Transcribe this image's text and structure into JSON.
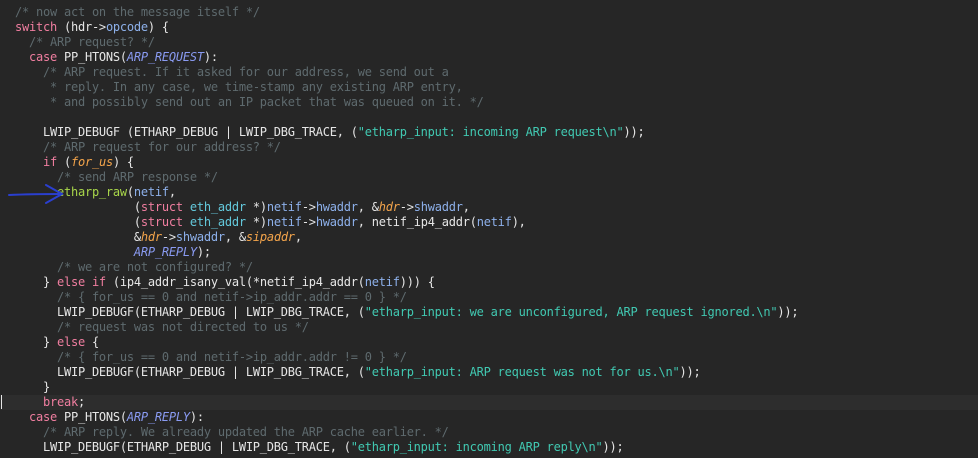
{
  "editor": {
    "theme_colors": {
      "background": "#262626",
      "comment": "#5e6a6e",
      "keyword": "#f07ea0",
      "function": "#a8d64a",
      "type": "#63c8db",
      "string": "#41c9b2",
      "parameter": "#f3a44b",
      "member": "#8db0ea",
      "enum_constant": "#8a9bf2",
      "annotation_arrow": "#2a3fd0"
    },
    "annotation_arrow_icon": "arrow-right-icon",
    "lines": [
      {
        "indent": "  ",
        "tokens": [
          {
            "t": "comment",
            "v": "/* now act on the message itself */"
          }
        ]
      },
      {
        "indent": "  ",
        "tokens": [
          {
            "t": "keyword",
            "v": "switch"
          },
          {
            "t": "plain",
            "v": " (hdr->"
          },
          {
            "t": "member",
            "v": "opcode"
          },
          {
            "t": "plain",
            "v": ") {"
          }
        ]
      },
      {
        "indent": "    ",
        "tokens": [
          {
            "t": "comment",
            "v": "/* ARP request? */"
          }
        ]
      },
      {
        "indent": "    ",
        "tokens": [
          {
            "t": "keyword",
            "v": "case"
          },
          {
            "t": "plain",
            "v": " PP_HTONS("
          },
          {
            "t": "enum",
            "v": "ARP_REQUEST"
          },
          {
            "t": "plain",
            "v": "):"
          }
        ]
      },
      {
        "indent": "      ",
        "tokens": [
          {
            "t": "comment",
            "v": "/* ARP request. If it asked for our address, we send out a"
          }
        ]
      },
      {
        "indent": "       ",
        "tokens": [
          {
            "t": "comment",
            "v": "* reply. In any case, we time-stamp any existing ARP entry,"
          }
        ]
      },
      {
        "indent": "       ",
        "tokens": [
          {
            "t": "comment",
            "v": "* and possibly send out an IP packet that was queued on it. */"
          }
        ]
      },
      {
        "indent": "",
        "tokens": []
      },
      {
        "indent": "      ",
        "tokens": [
          {
            "t": "plain",
            "v": "LWIP_DEBUGF (ETHARP_DEBUG | LWIP_DBG_TRACE, ("
          },
          {
            "t": "string",
            "v": "\"etharp_input: incoming ARP request\\n\""
          },
          {
            "t": "plain",
            "v": "));"
          }
        ]
      },
      {
        "indent": "      ",
        "tokens": [
          {
            "t": "comment",
            "v": "/* ARP request for our address? */"
          }
        ]
      },
      {
        "indent": "      ",
        "tokens": [
          {
            "t": "keyword",
            "v": "if"
          },
          {
            "t": "plain",
            "v": " ("
          },
          {
            "t": "param",
            "v": "for_us"
          },
          {
            "t": "plain",
            "v": ") {"
          }
        ]
      },
      {
        "indent": "        ",
        "tokens": [
          {
            "t": "comment",
            "v": "/* send ARP response */"
          }
        ]
      },
      {
        "indent": "        ",
        "tokens": [
          {
            "t": "func",
            "v": "etharp_raw"
          },
          {
            "t": "plain",
            "v": "("
          },
          {
            "t": "member",
            "v": "netif"
          },
          {
            "t": "plain",
            "v": ","
          }
        ]
      },
      {
        "indent": "                   ",
        "tokens": [
          {
            "t": "plain",
            "v": "("
          },
          {
            "t": "keyword",
            "v": "struct"
          },
          {
            "t": "plain",
            "v": " "
          },
          {
            "t": "type",
            "v": "eth_addr"
          },
          {
            "t": "plain",
            "v": " *)"
          },
          {
            "t": "member",
            "v": "netif"
          },
          {
            "t": "plain",
            "v": "->"
          },
          {
            "t": "member",
            "v": "hwaddr"
          },
          {
            "t": "plain",
            "v": ", &"
          },
          {
            "t": "param",
            "v": "hdr"
          },
          {
            "t": "plain",
            "v": "->"
          },
          {
            "t": "member",
            "v": "shwaddr"
          },
          {
            "t": "plain",
            "v": ","
          }
        ]
      },
      {
        "indent": "                   ",
        "tokens": [
          {
            "t": "plain",
            "v": "("
          },
          {
            "t": "keyword",
            "v": "struct"
          },
          {
            "t": "plain",
            "v": " "
          },
          {
            "t": "type",
            "v": "eth_addr"
          },
          {
            "t": "plain",
            "v": " *)"
          },
          {
            "t": "member",
            "v": "netif"
          },
          {
            "t": "plain",
            "v": "->"
          },
          {
            "t": "member",
            "v": "hwaddr"
          },
          {
            "t": "plain",
            "v": ", netif_ip4_addr("
          },
          {
            "t": "member",
            "v": "netif"
          },
          {
            "t": "plain",
            "v": "),"
          }
        ]
      },
      {
        "indent": "                   ",
        "tokens": [
          {
            "t": "plain",
            "v": "&"
          },
          {
            "t": "param",
            "v": "hdr"
          },
          {
            "t": "plain",
            "v": "->"
          },
          {
            "t": "member",
            "v": "shwaddr"
          },
          {
            "t": "plain",
            "v": ", &"
          },
          {
            "t": "param",
            "v": "sipaddr"
          },
          {
            "t": "plain",
            "v": ","
          }
        ]
      },
      {
        "indent": "                   ",
        "tokens": [
          {
            "t": "enum",
            "v": "ARP_REPLY"
          },
          {
            "t": "plain",
            "v": ");"
          }
        ]
      },
      {
        "indent": "        ",
        "tokens": [
          {
            "t": "comment",
            "v": "/* we are not configured? */"
          }
        ]
      },
      {
        "indent": "      ",
        "tokens": [
          {
            "t": "plain",
            "v": "} "
          },
          {
            "t": "keyword",
            "v": "else if"
          },
          {
            "t": "plain",
            "v": " (ip4_addr_isany_val(*netif_ip4_addr("
          },
          {
            "t": "member",
            "v": "netif"
          },
          {
            "t": "plain",
            "v": "))) {"
          }
        ]
      },
      {
        "indent": "        ",
        "tokens": [
          {
            "t": "comment",
            "v": "/* { for_us == 0 and netif->ip_addr.addr == 0 } */"
          }
        ]
      },
      {
        "indent": "        ",
        "tokens": [
          {
            "t": "plain",
            "v": "LWIP_DEBUGF(ETHARP_DEBUG | LWIP_DBG_TRACE, ("
          },
          {
            "t": "string",
            "v": "\"etharp_input: we are unconfigured, ARP request ignored.\\n\""
          },
          {
            "t": "plain",
            "v": "));"
          }
        ]
      },
      {
        "indent": "        ",
        "tokens": [
          {
            "t": "comment",
            "v": "/* request was not directed to us */"
          }
        ]
      },
      {
        "indent": "      ",
        "tokens": [
          {
            "t": "plain",
            "v": "} "
          },
          {
            "t": "keyword",
            "v": "else"
          },
          {
            "t": "plain",
            "v": " {"
          }
        ]
      },
      {
        "indent": "        ",
        "tokens": [
          {
            "t": "comment",
            "v": "/* { for_us == 0 and netif->ip_addr.addr != 0 } */"
          }
        ]
      },
      {
        "indent": "        ",
        "tokens": [
          {
            "t": "plain",
            "v": "LWIP_DEBUGF(ETHARP_DEBUG | LWIP_DBG_TRACE, ("
          },
          {
            "t": "string",
            "v": "\"etharp_input: ARP request was not for us.\\n\""
          },
          {
            "t": "plain",
            "v": "));"
          }
        ]
      },
      {
        "indent": "      ",
        "tokens": [
          {
            "t": "plain",
            "v": "}"
          }
        ]
      },
      {
        "indent": "      ",
        "current": true,
        "tokens": [
          {
            "t": "keyword",
            "v": "break"
          },
          {
            "t": "plain",
            "v": ";"
          }
        ]
      },
      {
        "indent": "    ",
        "tokens": [
          {
            "t": "keyword",
            "v": "case"
          },
          {
            "t": "plain",
            "v": " PP_HTONS("
          },
          {
            "t": "enum",
            "v": "ARP_REPLY"
          },
          {
            "t": "plain",
            "v": "):"
          }
        ]
      },
      {
        "indent": "      ",
        "tokens": [
          {
            "t": "comment",
            "v": "/* ARP reply. We already updated the ARP cache earlier. */"
          }
        ]
      },
      {
        "indent": "      ",
        "tokens": [
          {
            "t": "plain",
            "v": "LWIP_DEBUGF(ETHARP_DEBUG | LWIP_DBG_TRACE, ("
          },
          {
            "t": "string",
            "v": "\"etharp_input: incoming ARP reply\\n\""
          },
          {
            "t": "plain",
            "v": "));"
          }
        ]
      }
    ]
  }
}
